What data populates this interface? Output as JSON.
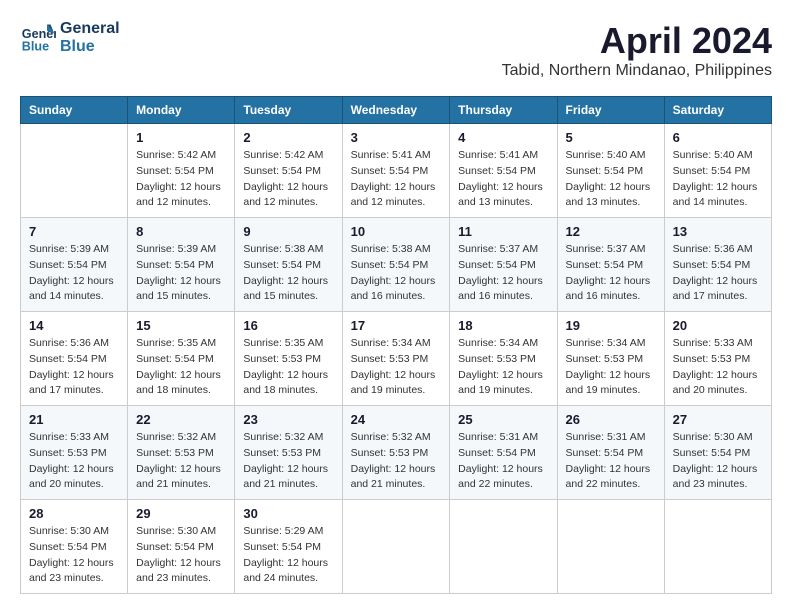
{
  "header": {
    "logo_line1": "General",
    "logo_line2": "Blue",
    "month_title": "April 2024",
    "location": "Tabid, Northern Mindanao, Philippines"
  },
  "weekdays": [
    "Sunday",
    "Monday",
    "Tuesday",
    "Wednesday",
    "Thursday",
    "Friday",
    "Saturday"
  ],
  "weeks": [
    [
      {
        "day": "",
        "info": ""
      },
      {
        "day": "1",
        "info": "Sunrise: 5:42 AM\nSunset: 5:54 PM\nDaylight: 12 hours\nand 12 minutes."
      },
      {
        "day": "2",
        "info": "Sunrise: 5:42 AM\nSunset: 5:54 PM\nDaylight: 12 hours\nand 12 minutes."
      },
      {
        "day": "3",
        "info": "Sunrise: 5:41 AM\nSunset: 5:54 PM\nDaylight: 12 hours\nand 12 minutes."
      },
      {
        "day": "4",
        "info": "Sunrise: 5:41 AM\nSunset: 5:54 PM\nDaylight: 12 hours\nand 13 minutes."
      },
      {
        "day": "5",
        "info": "Sunrise: 5:40 AM\nSunset: 5:54 PM\nDaylight: 12 hours\nand 13 minutes."
      },
      {
        "day": "6",
        "info": "Sunrise: 5:40 AM\nSunset: 5:54 PM\nDaylight: 12 hours\nand 14 minutes."
      }
    ],
    [
      {
        "day": "7",
        "info": "Sunrise: 5:39 AM\nSunset: 5:54 PM\nDaylight: 12 hours\nand 14 minutes."
      },
      {
        "day": "8",
        "info": "Sunrise: 5:39 AM\nSunset: 5:54 PM\nDaylight: 12 hours\nand 15 minutes."
      },
      {
        "day": "9",
        "info": "Sunrise: 5:38 AM\nSunset: 5:54 PM\nDaylight: 12 hours\nand 15 minutes."
      },
      {
        "day": "10",
        "info": "Sunrise: 5:38 AM\nSunset: 5:54 PM\nDaylight: 12 hours\nand 16 minutes."
      },
      {
        "day": "11",
        "info": "Sunrise: 5:37 AM\nSunset: 5:54 PM\nDaylight: 12 hours\nand 16 minutes."
      },
      {
        "day": "12",
        "info": "Sunrise: 5:37 AM\nSunset: 5:54 PM\nDaylight: 12 hours\nand 16 minutes."
      },
      {
        "day": "13",
        "info": "Sunrise: 5:36 AM\nSunset: 5:54 PM\nDaylight: 12 hours\nand 17 minutes."
      }
    ],
    [
      {
        "day": "14",
        "info": "Sunrise: 5:36 AM\nSunset: 5:54 PM\nDaylight: 12 hours\nand 17 minutes."
      },
      {
        "day": "15",
        "info": "Sunrise: 5:35 AM\nSunset: 5:54 PM\nDaylight: 12 hours\nand 18 minutes."
      },
      {
        "day": "16",
        "info": "Sunrise: 5:35 AM\nSunset: 5:53 PM\nDaylight: 12 hours\nand 18 minutes."
      },
      {
        "day": "17",
        "info": "Sunrise: 5:34 AM\nSunset: 5:53 PM\nDaylight: 12 hours\nand 19 minutes."
      },
      {
        "day": "18",
        "info": "Sunrise: 5:34 AM\nSunset: 5:53 PM\nDaylight: 12 hours\nand 19 minutes."
      },
      {
        "day": "19",
        "info": "Sunrise: 5:34 AM\nSunset: 5:53 PM\nDaylight: 12 hours\nand 19 minutes."
      },
      {
        "day": "20",
        "info": "Sunrise: 5:33 AM\nSunset: 5:53 PM\nDaylight: 12 hours\nand 20 minutes."
      }
    ],
    [
      {
        "day": "21",
        "info": "Sunrise: 5:33 AM\nSunset: 5:53 PM\nDaylight: 12 hours\nand 20 minutes."
      },
      {
        "day": "22",
        "info": "Sunrise: 5:32 AM\nSunset: 5:53 PM\nDaylight: 12 hours\nand 21 minutes."
      },
      {
        "day": "23",
        "info": "Sunrise: 5:32 AM\nSunset: 5:53 PM\nDaylight: 12 hours\nand 21 minutes."
      },
      {
        "day": "24",
        "info": "Sunrise: 5:32 AM\nSunset: 5:53 PM\nDaylight: 12 hours\nand 21 minutes."
      },
      {
        "day": "25",
        "info": "Sunrise: 5:31 AM\nSunset: 5:54 PM\nDaylight: 12 hours\nand 22 minutes."
      },
      {
        "day": "26",
        "info": "Sunrise: 5:31 AM\nSunset: 5:54 PM\nDaylight: 12 hours\nand 22 minutes."
      },
      {
        "day": "27",
        "info": "Sunrise: 5:30 AM\nSunset: 5:54 PM\nDaylight: 12 hours\nand 23 minutes."
      }
    ],
    [
      {
        "day": "28",
        "info": "Sunrise: 5:30 AM\nSunset: 5:54 PM\nDaylight: 12 hours\nand 23 minutes."
      },
      {
        "day": "29",
        "info": "Sunrise: 5:30 AM\nSunset: 5:54 PM\nDaylight: 12 hours\nand 23 minutes."
      },
      {
        "day": "30",
        "info": "Sunrise: 5:29 AM\nSunset: 5:54 PM\nDaylight: 12 hours\nand 24 minutes."
      },
      {
        "day": "",
        "info": ""
      },
      {
        "day": "",
        "info": ""
      },
      {
        "day": "",
        "info": ""
      },
      {
        "day": "",
        "info": ""
      }
    ]
  ]
}
